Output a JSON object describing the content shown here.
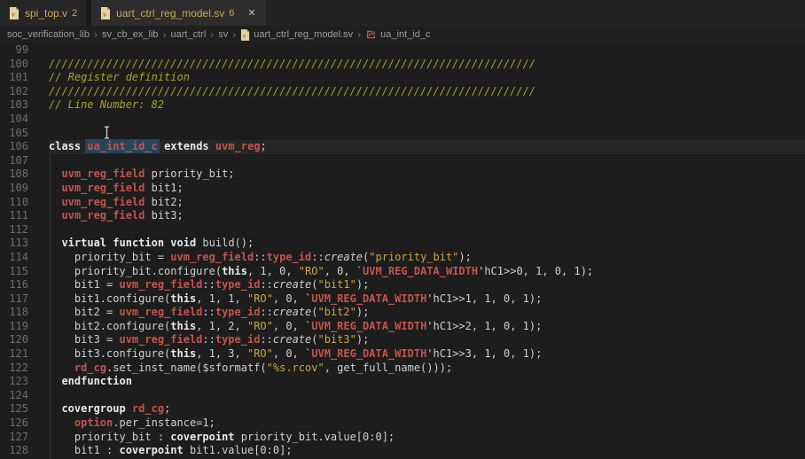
{
  "tabs": [
    {
      "label": "spi_top.v",
      "badge": "2"
    },
    {
      "label": "uart_ctrl_reg_model.sv",
      "badge": "6",
      "close_glyph": "✕"
    }
  ],
  "breadcrumb": {
    "separator": "›",
    "items": [
      "soc_verification_lib",
      "sv_cb_ex_lib",
      "uart_ctrl",
      "sv"
    ],
    "file": "uart_ctrl_reg_model.sv",
    "symbol": "ua_int_id_c"
  },
  "colors": {
    "editor_bg": "#1d1d1d",
    "current_line_bg": "#262626",
    "keyword_white": "#e9e9e9",
    "type_red": "#c4544c",
    "string_gold": "#cfa73d",
    "comment_olive": "#a6a626",
    "tab_label_yellow": "#cda84f",
    "word_highlight_bg": "#25455c",
    "line_number_grey": "#6e6e6e"
  },
  "editor": {
    "current_line": 106,
    "lines": [
      {
        "n": 99,
        "tokens": []
      },
      {
        "n": 100,
        "tokens": [
          [
            "cmt",
            "////////////////////////////////////////////////////////////////////////////"
          ]
        ]
      },
      {
        "n": 101,
        "tokens": [
          [
            "cmt",
            "// Register definition"
          ]
        ]
      },
      {
        "n": 102,
        "tokens": [
          [
            "cmt",
            "////////////////////////////////////////////////////////////////////////////"
          ]
        ]
      },
      {
        "n": 103,
        "tokens": [
          [
            "cmt",
            "// Line Number: 82"
          ]
        ]
      },
      {
        "n": 104,
        "tokens": []
      },
      {
        "n": 105,
        "tokens": []
      },
      {
        "n": 106,
        "tokens": [
          [
            "kw",
            "class"
          ],
          [
            "pln",
            " "
          ],
          [
            "hlword",
            "ua_int_id_c"
          ],
          [
            "pln",
            " "
          ],
          [
            "kw",
            "extends"
          ],
          [
            "pln",
            " "
          ],
          [
            "type",
            "uvm_reg"
          ],
          [
            "pln",
            ";"
          ]
        ]
      },
      {
        "n": 107,
        "tokens": []
      },
      {
        "n": 108,
        "tokens": [
          [
            "pln",
            "  "
          ],
          [
            "type",
            "uvm_reg_field"
          ],
          [
            "pln",
            " priority_bit;"
          ]
        ]
      },
      {
        "n": 109,
        "tokens": [
          [
            "pln",
            "  "
          ],
          [
            "type",
            "uvm_reg_field"
          ],
          [
            "pln",
            " bit1;"
          ]
        ]
      },
      {
        "n": 110,
        "tokens": [
          [
            "pln",
            "  "
          ],
          [
            "type",
            "uvm_reg_field"
          ],
          [
            "pln",
            " bit2;"
          ]
        ]
      },
      {
        "n": 111,
        "tokens": [
          [
            "pln",
            "  "
          ],
          [
            "type",
            "uvm_reg_field"
          ],
          [
            "pln",
            " bit3;"
          ]
        ]
      },
      {
        "n": 112,
        "tokens": []
      },
      {
        "n": 113,
        "tokens": [
          [
            "pln",
            "  "
          ],
          [
            "kw",
            "virtual"
          ],
          [
            "pln",
            " "
          ],
          [
            "kw",
            "function"
          ],
          [
            "pln",
            " "
          ],
          [
            "kw",
            "void"
          ],
          [
            "pln",
            " build();"
          ]
        ]
      },
      {
        "n": 114,
        "tokens": [
          [
            "pln",
            "    priority_bit = "
          ],
          [
            "type",
            "uvm_reg_field"
          ],
          [
            "pln",
            "::"
          ],
          [
            "type",
            "type_id"
          ],
          [
            "pln",
            "::"
          ],
          [
            "ital",
            "create"
          ],
          [
            "pln",
            "("
          ],
          [
            "str",
            "\"priority_bit\""
          ],
          [
            "pln",
            ");"
          ]
        ]
      },
      {
        "n": 115,
        "tokens": [
          [
            "pln",
            "    priority_bit.configure("
          ],
          [
            "kw",
            "this"
          ],
          [
            "pln",
            ", 1, 0, "
          ],
          [
            "str",
            "\"RO\""
          ],
          [
            "pln",
            ", 0, `"
          ],
          [
            "type",
            "UVM_REG_DATA_WIDTH"
          ],
          [
            "pln",
            "'hC1>>0, 1, 0, 1);"
          ]
        ]
      },
      {
        "n": 116,
        "tokens": [
          [
            "pln",
            "    bit1 = "
          ],
          [
            "type",
            "uvm_reg_field"
          ],
          [
            "pln",
            "::"
          ],
          [
            "type",
            "type_id"
          ],
          [
            "pln",
            "::"
          ],
          [
            "ital",
            "create"
          ],
          [
            "pln",
            "("
          ],
          [
            "str",
            "\"bit1\""
          ],
          [
            "pln",
            ");"
          ]
        ]
      },
      {
        "n": 117,
        "tokens": [
          [
            "pln",
            "    bit1.configure("
          ],
          [
            "kw",
            "this"
          ],
          [
            "pln",
            ", 1, 1, "
          ],
          [
            "str",
            "\"RO\""
          ],
          [
            "pln",
            ", 0, `"
          ],
          [
            "type",
            "UVM_REG_DATA_WIDTH"
          ],
          [
            "pln",
            "'hC1>>1, 1, 0, 1);"
          ]
        ]
      },
      {
        "n": 118,
        "tokens": [
          [
            "pln",
            "    bit2 = "
          ],
          [
            "type",
            "uvm_reg_field"
          ],
          [
            "pln",
            "::"
          ],
          [
            "type",
            "type_id"
          ],
          [
            "pln",
            "::"
          ],
          [
            "ital",
            "create"
          ],
          [
            "pln",
            "("
          ],
          [
            "str",
            "\"bit2\""
          ],
          [
            "pln",
            ");"
          ]
        ]
      },
      {
        "n": 119,
        "tokens": [
          [
            "pln",
            "    bit2.configure("
          ],
          [
            "kw",
            "this"
          ],
          [
            "pln",
            ", 1, 2, "
          ],
          [
            "str",
            "\"RO\""
          ],
          [
            "pln",
            ", 0, `"
          ],
          [
            "type",
            "UVM_REG_DATA_WIDTH"
          ],
          [
            "pln",
            "'hC1>>2, 1, 0, 1);"
          ]
        ]
      },
      {
        "n": 120,
        "tokens": [
          [
            "pln",
            "    bit3 = "
          ],
          [
            "type",
            "uvm_reg_field"
          ],
          [
            "pln",
            "::"
          ],
          [
            "type",
            "type_id"
          ],
          [
            "pln",
            "::"
          ],
          [
            "ital",
            "create"
          ],
          [
            "pln",
            "("
          ],
          [
            "str",
            "\"bit3\""
          ],
          [
            "pln",
            ");"
          ]
        ]
      },
      {
        "n": 121,
        "tokens": [
          [
            "pln",
            "    bit3.configure("
          ],
          [
            "kw",
            "this"
          ],
          [
            "pln",
            ", 1, 3, "
          ],
          [
            "str",
            "\"RO\""
          ],
          [
            "pln",
            ", 0, `"
          ],
          [
            "type",
            "UVM_REG_DATA_WIDTH"
          ],
          [
            "pln",
            "'hC1>>3, 1, 0, 1);"
          ]
        ]
      },
      {
        "n": 122,
        "tokens": [
          [
            "pln",
            "    "
          ],
          [
            "type",
            "rd_cg"
          ],
          [
            "pln",
            ".set_inst_name($sformatf("
          ],
          [
            "str",
            "\"%s.rcov\""
          ],
          [
            "pln",
            ", get_full_name()));"
          ]
        ]
      },
      {
        "n": 123,
        "tokens": [
          [
            "pln",
            "  "
          ],
          [
            "kw",
            "endfunction"
          ]
        ]
      },
      {
        "n": 124,
        "tokens": []
      },
      {
        "n": 125,
        "tokens": [
          [
            "pln",
            "  "
          ],
          [
            "kw",
            "covergroup"
          ],
          [
            "pln",
            " "
          ],
          [
            "type",
            "rd_cg"
          ],
          [
            "pln",
            ";"
          ]
        ]
      },
      {
        "n": 126,
        "tokens": [
          [
            "pln",
            "    "
          ],
          [
            "type",
            "option"
          ],
          [
            "pln",
            ".per_instance=1;"
          ]
        ]
      },
      {
        "n": 127,
        "tokens": [
          [
            "pln",
            "    priority_bit : "
          ],
          [
            "kw",
            "coverpoint"
          ],
          [
            "pln",
            " priority_bit.value[0:0];"
          ]
        ]
      },
      {
        "n": 128,
        "tokens": [
          [
            "pln",
            "    bit1 : "
          ],
          [
            "kw",
            "coverpoint"
          ],
          [
            "pln",
            " bit1.value[0:0];"
          ]
        ]
      }
    ]
  }
}
